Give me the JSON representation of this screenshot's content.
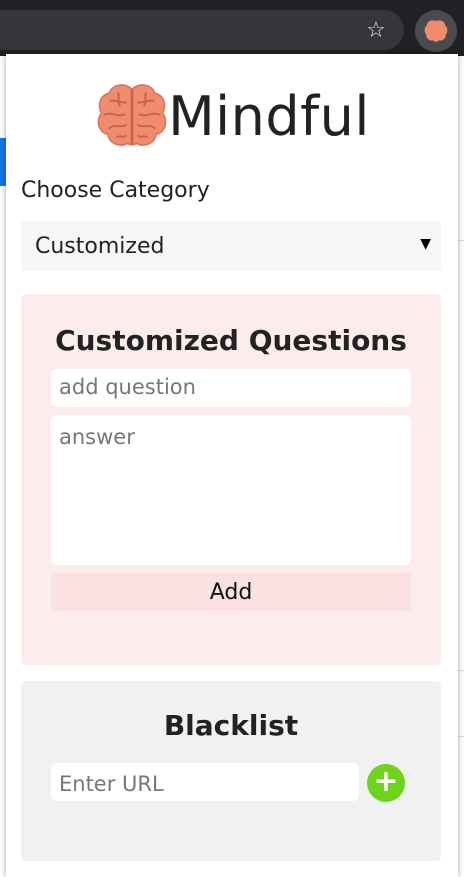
{
  "browser": {
    "star_icon": "☆",
    "extension_icon": "brain-icon"
  },
  "app": {
    "title": "Mindful",
    "logo_icon": "brain-icon",
    "logo_color": "#f08c6e"
  },
  "category": {
    "label": "Choose Category",
    "selected": "Customized",
    "arrow": "▼"
  },
  "custom_questions": {
    "title": "Customized Questions",
    "question_placeholder": "add question",
    "answer_placeholder": "answer",
    "add_label": "Add",
    "background": "#fcecec"
  },
  "blacklist": {
    "title": "Blacklist",
    "url_placeholder": "Enter URL",
    "add_icon": "+",
    "add_color": "#6dd41b"
  }
}
